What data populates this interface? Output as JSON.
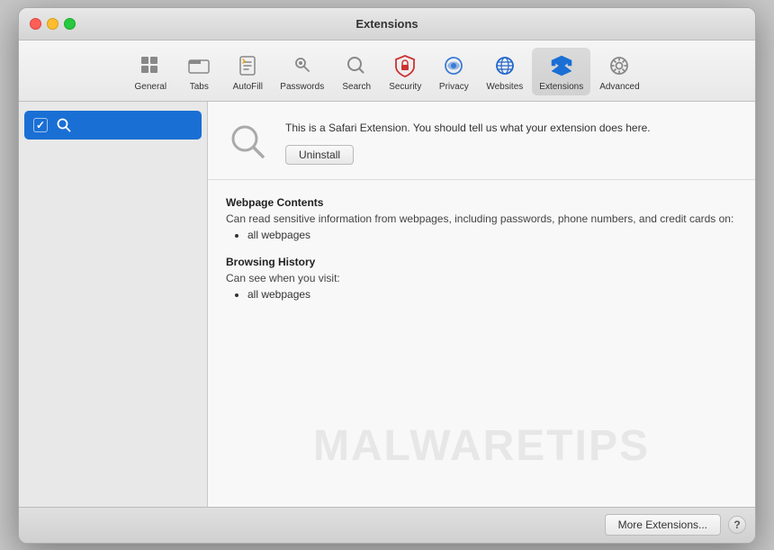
{
  "window": {
    "title": "Extensions"
  },
  "toolbar": {
    "items": [
      {
        "id": "general",
        "label": "General",
        "icon": "general"
      },
      {
        "id": "tabs",
        "label": "Tabs",
        "icon": "tabs"
      },
      {
        "id": "autofill",
        "label": "AutoFill",
        "icon": "autofill"
      },
      {
        "id": "passwords",
        "label": "Passwords",
        "icon": "passwords"
      },
      {
        "id": "search",
        "label": "Search",
        "icon": "search"
      },
      {
        "id": "security",
        "label": "Security",
        "icon": "security"
      },
      {
        "id": "privacy",
        "label": "Privacy",
        "icon": "privacy"
      },
      {
        "id": "websites",
        "label": "Websites",
        "icon": "websites"
      },
      {
        "id": "extensions",
        "label": "Extensions",
        "icon": "extensions",
        "active": true
      },
      {
        "id": "advanced",
        "label": "Advanced",
        "icon": "advanced"
      }
    ]
  },
  "sidebar": {
    "extensions": [
      {
        "id": "search-ext",
        "label": "Search",
        "enabled": true,
        "selected": true
      }
    ]
  },
  "detail": {
    "description": "This is a Safari Extension. You should tell us what your extension does here.",
    "uninstall_label": "Uninstall",
    "permissions": [
      {
        "title": "Webpage Contents",
        "description": "Can read sensitive information from webpages, including passwords, phone numbers, and credit cards on:",
        "items": [
          "all webpages"
        ]
      },
      {
        "title": "Browsing History",
        "description": "Can see when you visit:",
        "items": [
          "all webpages"
        ]
      }
    ]
  },
  "bottom_bar": {
    "more_extensions_label": "More Extensions...",
    "help_label": "?"
  },
  "watermark": {
    "text": "MALWARETIPS"
  }
}
